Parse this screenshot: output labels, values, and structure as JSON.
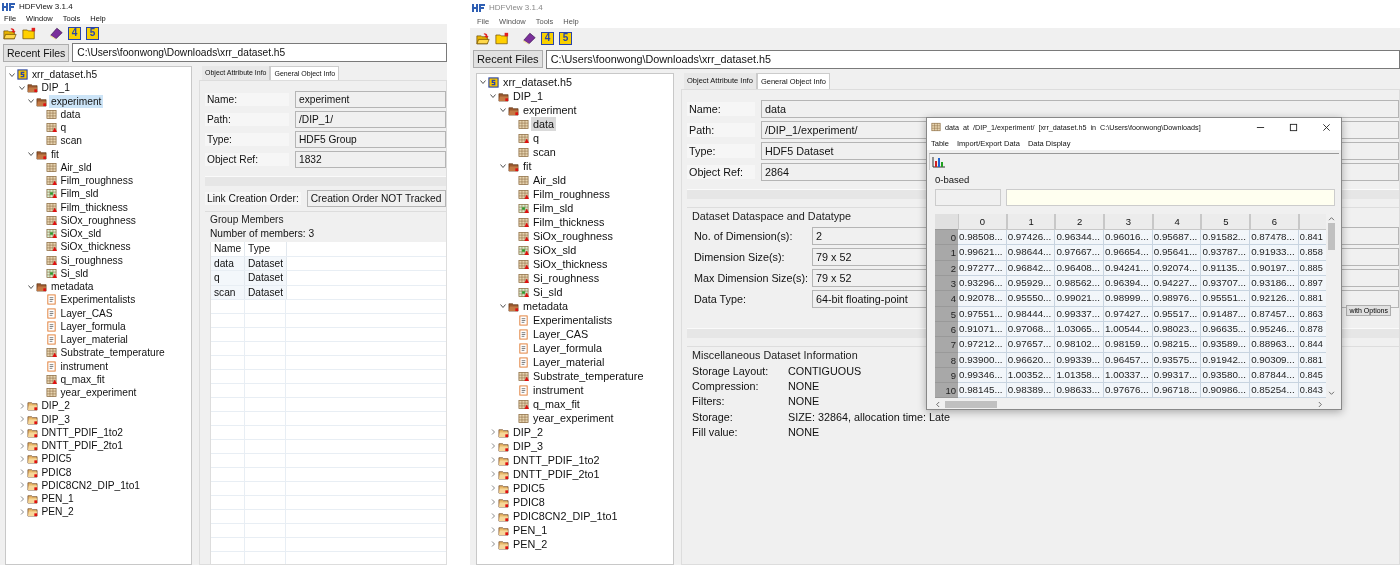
{
  "windows": [
    {
      "title": "HDFView 3.1.4",
      "menu": [
        "File",
        "Window",
        "Tools",
        "Help"
      ],
      "toolbar": [
        {
          "kind": "open-file"
        },
        {
          "kind": "new-file"
        },
        {
          "kind": "help-book"
        },
        {
          "kind": "hdf4",
          "label": "4"
        },
        {
          "kind": "hdf5",
          "label": "5"
        }
      ],
      "recent_files": "Recent Files",
      "file_path": "C:\\Users\\foonwong\\Downloads\\xrr_dataset.h5",
      "tree": [
        {
          "label": "xrr_dataset.h5",
          "kind": "file",
          "expanded": true,
          "selected": false,
          "children": [
            {
              "label": "DIP_1",
              "kind": "group",
              "expanded": true,
              "selected": false,
              "children": [
                {
                  "label": "experiment",
                  "kind": "group",
                  "expanded": true,
                  "selected": true,
                  "children": [
                    {
                      "label": "data",
                      "kind": "table",
                      "selected": false
                    },
                    {
                      "label": "q",
                      "kind": "tagged",
                      "selected": false
                    },
                    {
                      "label": "scan",
                      "kind": "table",
                      "selected": false
                    }
                  ]
                },
                {
                  "label": "fit",
                  "kind": "group",
                  "expanded": true,
                  "selected": false,
                  "children": [
                    {
                      "label": "Air_sld",
                      "kind": "table",
                      "selected": false
                    },
                    {
                      "label": "Film_roughness",
                      "kind": "tagged",
                      "selected": false
                    },
                    {
                      "label": "Film_sld",
                      "kind": "colored",
                      "selected": false
                    },
                    {
                      "label": "Film_thickness",
                      "kind": "tagged",
                      "selected": false
                    },
                    {
                      "label": "SiOx_roughness",
                      "kind": "tagged",
                      "selected": false
                    },
                    {
                      "label": "SiOx_sld",
                      "kind": "colored",
                      "selected": false
                    },
                    {
                      "label": "SiOx_thickness",
                      "kind": "tagged",
                      "selected": false
                    },
                    {
                      "label": "Si_roughness",
                      "kind": "tagged",
                      "selected": false
                    },
                    {
                      "label": "Si_sld",
                      "kind": "colored",
                      "selected": false
                    }
                  ]
                },
                {
                  "label": "metadata",
                  "kind": "group",
                  "expanded": true,
                  "selected": false,
                  "children": [
                    {
                      "label": "Experimentalists",
                      "kind": "text",
                      "selected": false
                    },
                    {
                      "label": "Layer_CAS",
                      "kind": "text",
                      "selected": false
                    },
                    {
                      "label": "Layer_formula",
                      "kind": "text",
                      "selected": false
                    },
                    {
                      "label": "Layer_material",
                      "kind": "text",
                      "selected": false
                    },
                    {
                      "label": "Substrate_temperature",
                      "kind": "tagged",
                      "selected": false
                    },
                    {
                      "label": "instrument",
                      "kind": "text",
                      "selected": false
                    },
                    {
                      "label": "q_max_fit",
                      "kind": "tagged",
                      "selected": false
                    },
                    {
                      "label": "year_experiment",
                      "kind": "table",
                      "selected": false
                    }
                  ]
                }
              ]
            },
            {
              "label": "DIP_2",
              "kind": "group",
              "expanded": false,
              "selected": false
            },
            {
              "label": "DIP_3",
              "kind": "group",
              "expanded": false,
              "selected": false
            },
            {
              "label": "DNTT_PDIF_1to2",
              "kind": "group",
              "expanded": false,
              "selected": false
            },
            {
              "label": "DNTT_PDIF_2to1",
              "kind": "group",
              "expanded": false,
              "selected": false
            },
            {
              "label": "PDIC5",
              "kind": "group",
              "expanded": false,
              "selected": false
            },
            {
              "label": "PDIC8",
              "kind": "group",
              "expanded": false,
              "selected": false
            },
            {
              "label": "PDIC8CN2_DIP_1to1",
              "kind": "group",
              "expanded": false,
              "selected": false
            },
            {
              "label": "PEN_1",
              "kind": "group",
              "expanded": false,
              "selected": false
            },
            {
              "label": "PEN_2",
              "kind": "group",
              "expanded": false,
              "selected": false
            }
          ]
        }
      ],
      "tabs": [
        {
          "label": "Object Attribute Info",
          "selected": false
        },
        {
          "label": "General Object Info",
          "selected": true
        }
      ],
      "info": {
        "kind": "group",
        "fields": [
          {
            "label": "Name:",
            "value": "experiment"
          },
          {
            "label": "Path:",
            "value": "/DIP_1/"
          },
          {
            "label": "Type:",
            "value": "HDF5 Group"
          },
          {
            "label": "Object Ref:",
            "value": "1832"
          }
        ],
        "link_creation_order": {
          "label": "Link Creation Order:",
          "value": "Creation Order NOT Tracked"
        },
        "group_members": {
          "title": "Group Members",
          "count": "Number of members: 3",
          "columns": [
            "Name",
            "Type"
          ],
          "rows": [
            [
              "data",
              "Dataset"
            ],
            [
              "q",
              "Dataset"
            ],
            [
              "scan",
              "Dataset"
            ]
          ]
        }
      }
    },
    {
      "title": "HDFView 3.1.4",
      "menu": [
        "File",
        "Window",
        "Tools",
        "Help"
      ],
      "toolbar": [
        {
          "kind": "open-file"
        },
        {
          "kind": "new-file"
        },
        {
          "kind": "help-book"
        },
        {
          "kind": "hdf4",
          "label": "4"
        },
        {
          "kind": "hdf5",
          "label": "5"
        }
      ],
      "recent_files": "Recent Files",
      "file_path": "C:\\Users\\foonwong\\Downloads\\xrr_dataset.h5",
      "tree": [
        {
          "label": "xrr_dataset.h5",
          "kind": "file",
          "expanded": true,
          "selected": false,
          "children": [
            {
              "label": "DIP_1",
              "kind": "group",
              "expanded": true,
              "selected": false,
              "children": [
                {
                  "label": "experiment",
                  "kind": "group",
                  "expanded": true,
                  "selected": false,
                  "children": [
                    {
                      "label": "data",
                      "kind": "table",
                      "selected": true
                    },
                    {
                      "label": "q",
                      "kind": "tagged",
                      "selected": false
                    },
                    {
                      "label": "scan",
                      "kind": "table",
                      "selected": false
                    }
                  ]
                },
                {
                  "label": "fit",
                  "kind": "group",
                  "expanded": true,
                  "selected": false,
                  "children": [
                    {
                      "label": "Air_sld",
                      "kind": "table",
                      "selected": false
                    },
                    {
                      "label": "Film_roughness",
                      "kind": "tagged",
                      "selected": false
                    },
                    {
                      "label": "Film_sld",
                      "kind": "colored",
                      "selected": false
                    },
                    {
                      "label": "Film_thickness",
                      "kind": "tagged",
                      "selected": false
                    },
                    {
                      "label": "SiOx_roughness",
                      "kind": "tagged",
                      "selected": false
                    },
                    {
                      "label": "SiOx_sld",
                      "kind": "colored",
                      "selected": false
                    },
                    {
                      "label": "SiOx_thickness",
                      "kind": "tagged",
                      "selected": false
                    },
                    {
                      "label": "Si_roughness",
                      "kind": "tagged",
                      "selected": false
                    },
                    {
                      "label": "Si_sld",
                      "kind": "colored",
                      "selected": false
                    }
                  ]
                },
                {
                  "label": "metadata",
                  "kind": "group",
                  "expanded": true,
                  "selected": false,
                  "children": [
                    {
                      "label": "Experimentalists",
                      "kind": "text",
                      "selected": false
                    },
                    {
                      "label": "Layer_CAS",
                      "kind": "text",
                      "selected": false
                    },
                    {
                      "label": "Layer_formula",
                      "kind": "text",
                      "selected": false
                    },
                    {
                      "label": "Layer_material",
                      "kind": "text",
                      "selected": false
                    },
                    {
                      "label": "Substrate_temperature",
                      "kind": "tagged",
                      "selected": false
                    },
                    {
                      "label": "instrument",
                      "kind": "text",
                      "selected": false
                    },
                    {
                      "label": "q_max_fit",
                      "kind": "tagged",
                      "selected": false
                    },
                    {
                      "label": "year_experiment",
                      "kind": "table",
                      "selected": false
                    }
                  ]
                }
              ]
            },
            {
              "label": "DIP_2",
              "kind": "group",
              "expanded": false,
              "selected": false
            },
            {
              "label": "DIP_3",
              "kind": "group",
              "expanded": false,
              "selected": false
            },
            {
              "label": "DNTT_PDIF_1to2",
              "kind": "group",
              "expanded": false,
              "selected": false
            },
            {
              "label": "DNTT_PDIF_2to1",
              "kind": "group",
              "expanded": false,
              "selected": false
            },
            {
              "label": "PDIC5",
              "kind": "group",
              "expanded": false,
              "selected": false
            },
            {
              "label": "PDIC8",
              "kind": "group",
              "expanded": false,
              "selected": false
            },
            {
              "label": "PDIC8CN2_DIP_1to1",
              "kind": "group",
              "expanded": false,
              "selected": false
            },
            {
              "label": "PEN_1",
              "kind": "group",
              "expanded": false,
              "selected": false
            },
            {
              "label": "PEN_2",
              "kind": "group",
              "expanded": false,
              "selected": false
            }
          ]
        }
      ],
      "tabs": [
        {
          "label": "Object Attribute Info",
          "selected": false
        },
        {
          "label": "General Object Info",
          "selected": true
        }
      ],
      "info": {
        "kind": "dataset",
        "fields": [
          {
            "label": "Name:",
            "value": "data"
          },
          {
            "label": "Path:",
            "value": "/DIP_1/experiment/"
          },
          {
            "label": "Type:",
            "value": "HDF5 Dataset"
          },
          {
            "label": "Object Ref:",
            "value": "2864"
          }
        ],
        "dataspace": {
          "title": "Dataset Dataspace and Datatype",
          "fields": [
            {
              "label": "No. of Dimension(s):",
              "value": "2"
            },
            {
              "label": "Dimension Size(s):",
              "value": "79 x 52"
            },
            {
              "label": "Max Dimension Size(s):",
              "value": "79 x 52"
            },
            {
              "label": "Data Type:",
              "value": "64-bit floating-point"
            }
          ],
          "button": "with Options"
        },
        "misc": {
          "title": "Miscellaneous Dataset Information",
          "fields": [
            {
              "label": "Storage Layout:",
              "value": "CONTIGUOUS"
            },
            {
              "label": "Compression:",
              "value": "NONE"
            },
            {
              "label": "Filters:",
              "value": "NONE"
            },
            {
              "label": "Storage:",
              "value": "SIZE: 32864, allocation time: Late"
            },
            {
              "label": "Fill value:",
              "value": "NONE"
            }
          ]
        }
      }
    }
  ],
  "data_window": {
    "title": "data  at  /DIP_1/experiment/  [xrr_dataset.h5  in  C:\\Users\\foonwong\\Downloads]",
    "menu": [
      "Table",
      "Import/Export Data",
      "Data Display"
    ],
    "index_base": "0-based",
    "columns": [
      "0",
      "1",
      "2",
      "3",
      "4",
      "5",
      "6"
    ],
    "rows": [
      {
        "index": "0",
        "cells": [
          "0.98508...",
          "0.97426...",
          "0.96344...",
          "0.96016...",
          "0.95687...",
          "0.91582...",
          "0.87478...",
          "0.841"
        ]
      },
      {
        "index": "1",
        "cells": [
          "0.99621...",
          "0.98644...",
          "0.97667...",
          "0.96654...",
          "0.95641...",
          "0.93787...",
          "0.91933...",
          "0.858"
        ]
      },
      {
        "index": "2",
        "cells": [
          "0.97277...",
          "0.96842...",
          "0.96408...",
          "0.94241...",
          "0.92074...",
          "0.91135...",
          "0.90197...",
          "0.885"
        ]
      },
      {
        "index": "3",
        "cells": [
          "0.93296...",
          "0.95929...",
          "0.98562...",
          "0.96394...",
          "0.94227...",
          "0.93707...",
          "0.93186...",
          "0.897"
        ]
      },
      {
        "index": "4",
        "cells": [
          "0.92078...",
          "0.95550...",
          "0.99021...",
          "0.98999...",
          "0.98976...",
          "0.95551...",
          "0.92126...",
          "0.881"
        ]
      },
      {
        "index": "5",
        "cells": [
          "0.97551...",
          "0.98444...",
          "0.99337...",
          "0.97427...",
          "0.95517...",
          "0.91487...",
          "0.87457...",
          "0.863"
        ]
      },
      {
        "index": "6",
        "cells": [
          "0.91071...",
          "0.97068...",
          "1.03065...",
          "1.00544...",
          "0.98023...",
          "0.96635...",
          "0.95246...",
          "0.878"
        ]
      },
      {
        "index": "7",
        "cells": [
          "0.97212...",
          "0.97657...",
          "0.98102...",
          "0.98159...",
          "0.98215...",
          "0.93589...",
          "0.88963...",
          "0.844"
        ]
      },
      {
        "index": "8",
        "cells": [
          "0.93900...",
          "0.96620...",
          "0.99339...",
          "0.96457...",
          "0.93575...",
          "0.91942...",
          "0.90309...",
          "0.881"
        ]
      },
      {
        "index": "9",
        "cells": [
          "0.99346...",
          "1.00352...",
          "1.01358...",
          "1.00337...",
          "0.99317...",
          "0.93580...",
          "0.87844...",
          "0.845"
        ]
      },
      {
        "index": "10",
        "cells": [
          "0.98145...",
          "0.98389...",
          "0.98633...",
          "0.97676...",
          "0.96718...",
          "0.90986...",
          "0.85254...",
          "0.843"
        ]
      }
    ]
  }
}
